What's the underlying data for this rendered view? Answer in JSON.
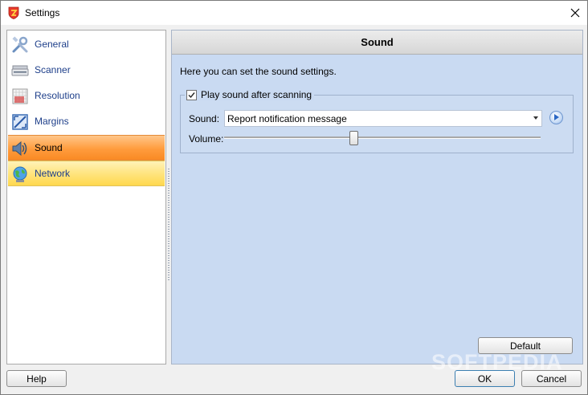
{
  "window": {
    "title": "Settings"
  },
  "sidebar": {
    "items": [
      {
        "label": "General",
        "icon": "tools-icon"
      },
      {
        "label": "Scanner",
        "icon": "scanner-icon"
      },
      {
        "label": "Resolution",
        "icon": "resolution-grid-icon"
      },
      {
        "label": "Margins",
        "icon": "margins-icon"
      },
      {
        "label": "Sound",
        "icon": "speaker-icon",
        "selected": true
      },
      {
        "label": "Network",
        "icon": "globe-icon"
      }
    ]
  },
  "panel": {
    "header": "Sound",
    "description": "Here you can set the sound settings.",
    "play_sound": {
      "label": "Play sound after scanning",
      "checked": true
    },
    "sound": {
      "label": "Sound:",
      "value": "Report notification message"
    },
    "volume": {
      "label": "Volume:",
      "level": 0.41
    },
    "default_button": "Default"
  },
  "footer": {
    "help": "Help",
    "ok": "OK",
    "cancel": "Cancel"
  },
  "watermark": "SOFTPEDIA",
  "colors": {
    "selected": "#ff9c3d",
    "hover": "#ffe37a",
    "panel_bg": "#c9daf2",
    "nav_text": "#1e3f8a"
  }
}
